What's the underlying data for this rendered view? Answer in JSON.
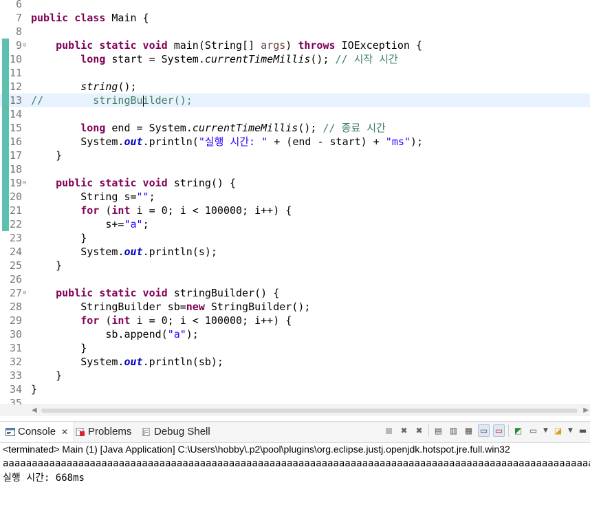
{
  "editor": {
    "lines": [
      {
        "n": "6",
        "html": ""
      },
      {
        "n": "7",
        "html": "<span class='kw'>public class</span> Main {"
      },
      {
        "n": "8",
        "html": ""
      },
      {
        "n": "9",
        "fold": true,
        "html": "    <span class='kw'>public static void</span> main(String[] <span class='param'>args</span>) <span class='kw'>throws</span> IOException {"
      },
      {
        "n": "10",
        "html": "        <span class='kw'>long</span> start = System.<span class='ital'>currentTimeMillis</span>(); <span class='cm'>// 시작 시간</span>"
      },
      {
        "n": "11",
        "html": ""
      },
      {
        "n": "12",
        "html": "        <span class='ital'>string</span>();"
      },
      {
        "n": "13",
        "current": true,
        "html": "<span class='cm'>//        stringBu<span class='caret'></span>ilder();</span>"
      },
      {
        "n": "14",
        "html": ""
      },
      {
        "n": "15",
        "html": "        <span class='kw'>long</span> end = System.<span class='ital'>currentTimeMillis</span>(); <span class='cm'>// 종료 시간</span>"
      },
      {
        "n": "16",
        "html": "        System.<span class='field'>out</span>.println(<span class='str'>\"실행 시간: \"</span> + (end - start) + <span class='str'>\"ms\"</span>);"
      },
      {
        "n": "17",
        "html": "    }"
      },
      {
        "n": "18",
        "html": ""
      },
      {
        "n": "19",
        "fold": true,
        "html": "    <span class='kw'>public static void</span> string() {"
      },
      {
        "n": "20",
        "html": "        String s=<span class='str'>\"\"</span>;"
      },
      {
        "n": "21",
        "html": "        <span class='kw'>for</span> (<span class='kw'>int</span> i = 0; i &lt; 100000; i++) {"
      },
      {
        "n": "22",
        "html": "            s+=<span class='str'>\"a\"</span>;"
      },
      {
        "n": "23",
        "html": "        }"
      },
      {
        "n": "24",
        "html": "        System.<span class='field'>out</span>.println(s);"
      },
      {
        "n": "25",
        "html": "    }"
      },
      {
        "n": "26",
        "html": ""
      },
      {
        "n": "27",
        "fold": true,
        "html": "    <span class='kw'>public static void</span> stringBuilder() {"
      },
      {
        "n": "28",
        "html": "        StringBuilder sb=<span class='kw'>new</span> StringBuilder();"
      },
      {
        "n": "29",
        "html": "        <span class='kw'>for</span> (<span class='kw'>int</span> i = 0; i &lt; 100000; i++) {"
      },
      {
        "n": "30",
        "html": "            sb.append(<span class='str'>\"a\"</span>);"
      },
      {
        "n": "31",
        "html": "        }"
      },
      {
        "n": "32",
        "html": "        System.<span class='field'>out</span>.println(sb);"
      },
      {
        "n": "33",
        "html": "    }"
      },
      {
        "n": "34",
        "html": "}"
      },
      {
        "n": "35",
        "html": ""
      }
    ]
  },
  "console": {
    "tabs": [
      {
        "label": "Console",
        "icon": "console-icon",
        "active": true,
        "close": "✕"
      },
      {
        "label": "Problems",
        "icon": "problems-icon"
      },
      {
        "label": "Debug Shell",
        "icon": "debug-shell-icon"
      }
    ],
    "status": "<terminated> Main (1) [Java Application] C:\\Users\\hobby\\.p2\\pool\\plugins\\org.eclipse.justj.openjdk.hotspot.jre.full.win32",
    "output": [
      "aaaaaaaaaaaaaaaaaaaaaaaaaaaaaaaaaaaaaaaaaaaaaaaaaaaaaaaaaaaaaaaaaaaaaaaaaaaaaaaaaaaaaaaaaaaaaaaaaaaaaaaaaa",
      "실행 시간: 668ms"
    ]
  },
  "colors": {
    "keyword": "#7f0055",
    "string": "#2a00ff",
    "comment": "#3f7f5f",
    "change_bar": "#5fbfae"
  }
}
